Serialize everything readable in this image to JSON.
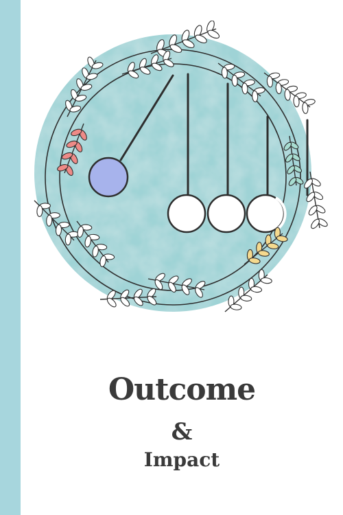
{
  "cover": {
    "title": "Outcome",
    "ampersand": "&",
    "subtitle": "Impact"
  },
  "colors": {
    "stripe": "#a7d6dd",
    "disc": "#9fd3d6",
    "disc_light": "#c4e6e7",
    "ink": "#2e2e2e",
    "leaf": "#ffffff",
    "leaf_pink": "#ee8a87",
    "leaf_green": "#a8ddd1",
    "leaf_yellow": "#f5d98e",
    "ball_blue": "#a7b3ec",
    "ball_white": "#ffffff",
    "text": "#3a3a3a"
  },
  "icons": {
    "illustration": "newtons-cradle-wreath-icon"
  }
}
